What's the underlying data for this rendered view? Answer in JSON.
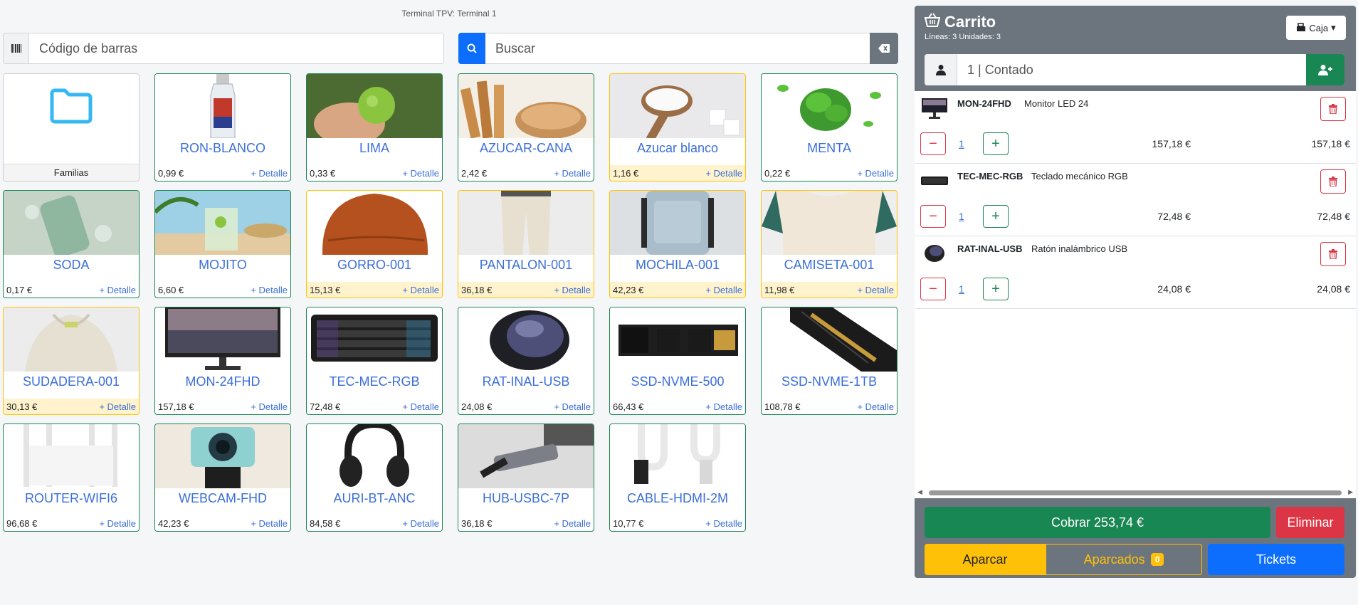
{
  "terminal": {
    "title": "Terminal TPV: Terminal 1"
  },
  "barcode": {
    "placeholder": "Código de barras",
    "icon": "barcode-icon"
  },
  "search": {
    "placeholder": "Buscar",
    "icon": "search-icon",
    "clear_icon": "backspace-icon"
  },
  "folder": {
    "label": "Familias",
    "icon": "folder-icon"
  },
  "products": [
    {
      "name": "RON-BLANCO",
      "price": "0,99 €",
      "detail": "+ Detalle",
      "low_stock": false
    },
    {
      "name": "LIMA",
      "price": "0,33 €",
      "detail": "+ Detalle",
      "low_stock": false
    },
    {
      "name": "AZUCAR-CANA",
      "price": "2,42 €",
      "detail": "+ Detalle",
      "low_stock": false
    },
    {
      "name": "Azucar blanco",
      "price": "1,16 €",
      "detail": "+ Detalle",
      "low_stock": true
    },
    {
      "name": "MENTA",
      "price": "0,22 €",
      "detail": "+ Detalle",
      "low_stock": false
    },
    {
      "name": "SODA",
      "price": "0,17 €",
      "detail": "+ Detalle",
      "low_stock": false
    },
    {
      "name": "MOJITO",
      "price": "6,60 €",
      "detail": "+ Detalle",
      "low_stock": false
    },
    {
      "name": "GORRO-001",
      "price": "15,13 €",
      "detail": "+ Detalle",
      "low_stock": true
    },
    {
      "name": "PANTALON-001",
      "price": "36,18 €",
      "detail": "+ Detalle",
      "low_stock": true
    },
    {
      "name": "MOCHILA-001",
      "price": "42,23 €",
      "detail": "+ Detalle",
      "low_stock": true
    },
    {
      "name": "CAMISETA-001",
      "price": "11,98 €",
      "detail": "+ Detalle",
      "low_stock": true
    },
    {
      "name": "SUDADERA-001",
      "price": "30,13 €",
      "detail": "+ Detalle",
      "low_stock": true
    },
    {
      "name": "MON-24FHD",
      "price": "157,18 €",
      "detail": "+ Detalle",
      "low_stock": false
    },
    {
      "name": "TEC-MEC-RGB",
      "price": "72,48 €",
      "detail": "+ Detalle",
      "low_stock": false
    },
    {
      "name": "RAT-INAL-USB",
      "price": "24,08 €",
      "detail": "+ Detalle",
      "low_stock": false
    },
    {
      "name": "SSD-NVME-500",
      "price": "66,43 €",
      "detail": "+ Detalle",
      "low_stock": false
    },
    {
      "name": "SSD-NVME-1TB",
      "price": "108,78 €",
      "detail": "+ Detalle",
      "low_stock": false
    },
    {
      "name": "ROUTER-WIFI6",
      "price": "96,68 €",
      "detail": "+ Detalle",
      "low_stock": false
    },
    {
      "name": "WEBCAM-FHD",
      "price": "42,23 €",
      "detail": "+ Detalle",
      "low_stock": false
    },
    {
      "name": "AURI-BT-ANC",
      "price": "84,58 €",
      "detail": "+ Detalle",
      "low_stock": false
    },
    {
      "name": "HUB-USBC-7P",
      "price": "36,18 €",
      "detail": "+ Detalle",
      "low_stock": false
    },
    {
      "name": "CABLE-HDMI-2M",
      "price": "10,77 €",
      "detail": "+ Detalle",
      "low_stock": false
    }
  ],
  "cart": {
    "title": "Carrito",
    "summary": "Líneas: 3 Unidades: 3",
    "caja_label": "Caja",
    "client": "1 | Contado",
    "lines": [
      {
        "code": "MON-24FHD",
        "description": "Monitor LED 24",
        "qty": "1",
        "unit_price": "157,18 €",
        "total": "157,18 €"
      },
      {
        "code": "TEC-MEC-RGB",
        "description": "Teclado mecánico RGB",
        "qty": "1",
        "unit_price": "72,48 €",
        "total": "72,48 €"
      },
      {
        "code": "RAT-INAL-USB",
        "description": "Ratón inalámbrico USB",
        "qty": "1",
        "unit_price": "24,08 €",
        "total": "24,08 €"
      }
    ],
    "cobrar_label": "Cobrar 253,74 €",
    "eliminar_label": "Eliminar",
    "aparcar_label": "Aparcar",
    "aparcados_label": "Aparcados",
    "aparcados_count": "0",
    "tickets_label": "Tickets"
  },
  "colors": {
    "primary": "#0d6efd",
    "success": "#198754",
    "danger": "#dc3545",
    "warning": "#ffc107",
    "secondary": "#6c757d"
  }
}
